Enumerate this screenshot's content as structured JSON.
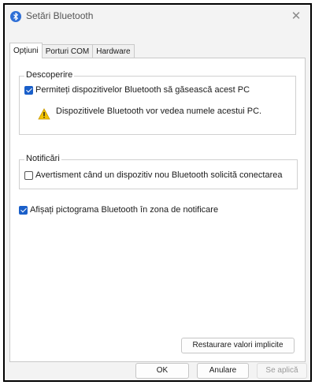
{
  "window": {
    "title": "Setări Bluetooth",
    "close_glyph": "✕"
  },
  "tabs": [
    {
      "label": "Opțiuni",
      "active": true
    },
    {
      "label": "Porturi COM",
      "active": false
    },
    {
      "label": "Hardware",
      "active": false
    }
  ],
  "discovery": {
    "legend": "Descoperire",
    "allow_label": "Permiteți dispozitivelor Bluetooth să găsească acest PC",
    "allow_checked": true,
    "warning_text": "Dispozitivele Bluetooth vor vedea numele acestui PC.",
    "warning_icon": "warning-icon"
  },
  "notifications": {
    "legend": "Notificări",
    "alert_label": "Avertisment când un dispozitiv nou Bluetooth solicită conectarea",
    "alert_checked": false
  },
  "tray_icon": {
    "label": "Afișați pictograma Bluetooth în zona de notificare",
    "checked": true
  },
  "buttons": {
    "restore_defaults": "Restaurare valori implicite",
    "ok": "OK",
    "cancel": "Anulare",
    "apply": "Se aplică"
  },
  "colors": {
    "accent": "#1a5fc9",
    "warning": "#f2c200"
  }
}
